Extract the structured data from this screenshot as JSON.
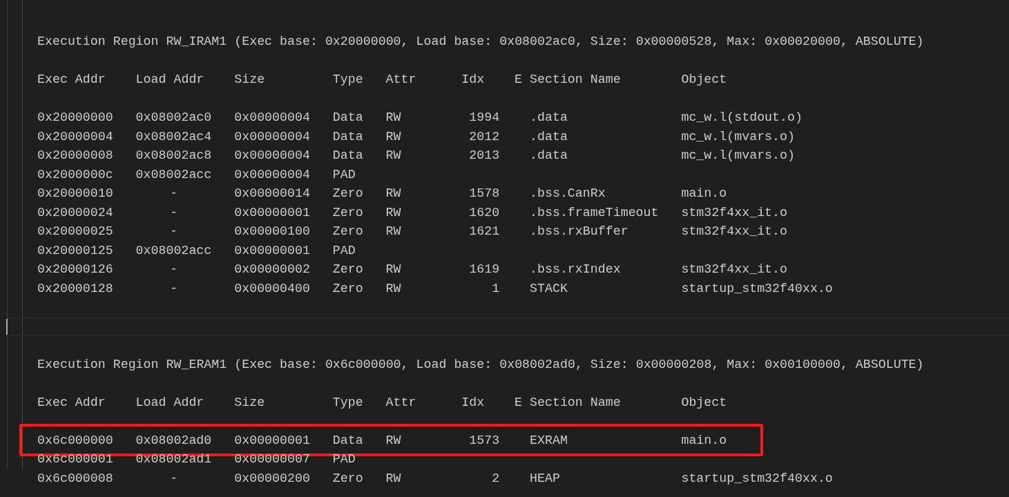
{
  "regions": [
    {
      "title": "Execution Region RW_IRAM1 (Exec base: 0x20000000, Load base: 0x08002ac0, Size: 0x00000528, Max: 0x00020000, ABSOLUTE)",
      "columns": [
        "Exec Addr",
        "Load Addr",
        "Size",
        "Type",
        "Attr",
        "Idx",
        "E",
        "Section Name",
        "Object"
      ],
      "rows": [
        {
          "exec": "0x20000000",
          "load": "0x08002ac0",
          "size": "0x00000004",
          "type": "Data",
          "attr": "RW",
          "idx": "1994",
          "section": ".data",
          "object": "mc_w.l(stdout.o)",
          "annotated": false
        },
        {
          "exec": "0x20000004",
          "load": "0x08002ac4",
          "size": "0x00000004",
          "type": "Data",
          "attr": "RW",
          "idx": "2012",
          "section": ".data",
          "object": "mc_w.l(mvars.o)",
          "annotated": false
        },
        {
          "exec": "0x20000008",
          "load": "0x08002ac8",
          "size": "0x00000004",
          "type": "Data",
          "attr": "RW",
          "idx": "2013",
          "section": ".data",
          "object": "mc_w.l(mvars.o)",
          "annotated": false
        },
        {
          "exec": "0x2000000c",
          "load": "0x08002acc",
          "size": "0x00000004",
          "type": "PAD",
          "annotated": false
        },
        {
          "exec": "0x20000010",
          "load": "-",
          "size": "0x00000014",
          "type": "Zero",
          "attr": "RW",
          "idx": "1578",
          "section": ".bss.CanRx",
          "object": "main.o",
          "annotated": false
        },
        {
          "exec": "0x20000024",
          "load": "-",
          "size": "0x00000001",
          "type": "Zero",
          "attr": "RW",
          "idx": "1620",
          "section": ".bss.frameTimeout",
          "object": "stm32f4xx_it.o",
          "annotated": false
        },
        {
          "exec": "0x20000025",
          "load": "-",
          "size": "0x00000100",
          "type": "Zero",
          "attr": "RW",
          "idx": "1621",
          "section": ".bss.rxBuffer",
          "object": "stm32f4xx_it.o",
          "annotated": false
        },
        {
          "exec": "0x20000125",
          "load": "0x08002acc",
          "size": "0x00000001",
          "type": "PAD",
          "annotated": false
        },
        {
          "exec": "0x20000126",
          "load": "-",
          "size": "0x00000002",
          "type": "Zero",
          "attr": "RW",
          "idx": "1619",
          "section": ".bss.rxIndex",
          "object": "stm32f4xx_it.o",
          "annotated": false
        },
        {
          "exec": "0x20000128",
          "load": "-",
          "size": "0x00000400",
          "type": "Zero",
          "attr": "RW",
          "idx": "1",
          "section": "STACK",
          "object": "startup_stm32f40xx.o",
          "annotated": false
        }
      ]
    },
    {
      "title": "Execution Region RW_ERAM1 (Exec base: 0x6c000000, Load base: 0x08002ad0, Size: 0x00000208, Max: 0x00100000, ABSOLUTE)",
      "columns": [
        "Exec Addr",
        "Load Addr",
        "Size",
        "Type",
        "Attr",
        "Idx",
        "E",
        "Section Name",
        "Object"
      ],
      "rows": [
        {
          "exec": "0x6c000000",
          "load": "0x08002ad0",
          "size": "0x00000001",
          "type": "Data",
          "attr": "RW",
          "idx": "1573",
          "section": "EXRAM",
          "object": "main.o",
          "annotated": true
        },
        {
          "exec": "0x6c000001",
          "load": "0x08002ad1",
          "size": "0x00000007",
          "type": "PAD",
          "annotated": false
        },
        {
          "exec": "0x6c000008",
          "load": "-",
          "size": "0x00000200",
          "type": "Zero",
          "attr": "RW",
          "idx": "2",
          "section": "HEAP",
          "object": "startup_stm32f40xx.o",
          "annotated": false
        }
      ]
    }
  ]
}
